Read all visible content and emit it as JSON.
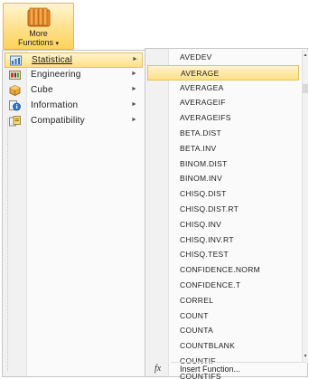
{
  "ribbon": {
    "button_line1": "More",
    "button_line2": "Functions",
    "button_caret": "▾",
    "icon": "function-library-icon"
  },
  "categories": [
    {
      "label": "Statistical",
      "icon": "statistical-icon",
      "arrow": "►",
      "selected": true
    },
    {
      "label": "Engineering",
      "icon": "engineering-icon",
      "arrow": "►",
      "selected": false
    },
    {
      "label": "Cube",
      "icon": "cube-icon",
      "arrow": "►",
      "selected": false
    },
    {
      "label": "Information",
      "icon": "information-icon",
      "arrow": "►",
      "selected": false
    },
    {
      "label": "Compatibility",
      "icon": "compatibility-icon",
      "arrow": "►",
      "selected": false
    }
  ],
  "functions": [
    "AVEDEV",
    "AVERAGE",
    "AVERAGEA",
    "AVERAGEIF",
    "AVERAGEIFS",
    "BETA.DIST",
    "BETA.INV",
    "BINOM.DIST",
    "BINOM.INV",
    "CHISQ.DIST",
    "CHISQ.DIST.RT",
    "CHISQ.INV",
    "CHISQ.INV.RT",
    "CHISQ.TEST",
    "CONFIDENCE.NORM",
    "CONFIDENCE.T",
    "CORREL",
    "COUNT",
    "COUNTA",
    "COUNTBLANK",
    "COUNTIF",
    "COUNTIFS"
  ],
  "highlighted_function": "AVERAGE",
  "insert_function": {
    "label": "Insert Function...",
    "icon": "fx-icon",
    "glyph": "fx"
  },
  "scroll": {
    "up": "▲",
    "down": "▼"
  },
  "colors": {
    "highlight_top": "#fff4cc",
    "highlight_bottom": "#ffdf86",
    "highlight_border": "#e5c065"
  }
}
